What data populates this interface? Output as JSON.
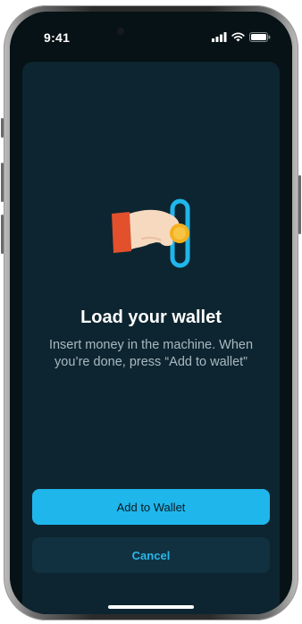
{
  "status_bar": {
    "time": "9:41",
    "icons": [
      "signal-icon",
      "wifi-icon",
      "battery-icon"
    ]
  },
  "screen": {
    "illustration": "hand-inserting-coin-icon",
    "title": "Load your wallet",
    "subtitle": "Insert money in the machine. When you’re done, press “Add to wallet”",
    "primary_button_label": "Add to Wallet",
    "secondary_button_label": "Cancel"
  },
  "colors": {
    "background": "#071216",
    "sheet": "#0d2530",
    "accent": "#1fb6ec",
    "secondary_button_bg": "#123140",
    "coin": "#f5b01c",
    "sleeve": "#e3502c"
  }
}
